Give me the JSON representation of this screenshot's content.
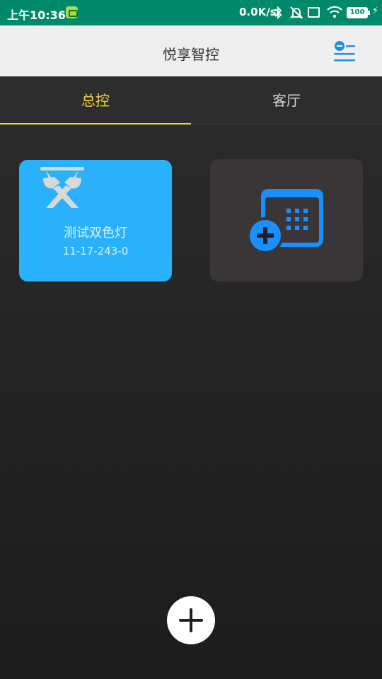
{
  "status_bar": {
    "time": "上午10:36",
    "net_speed": "0.0K/s",
    "battery": "100",
    "icons": [
      "app-notification-icon",
      "bluetooth-icon",
      "bell-muted-icon",
      "sim-off-icon",
      "wifi-icon",
      "battery-icon",
      "charging-icon"
    ]
  },
  "header": {
    "title": "悦享智控",
    "menu_icon": "list-menu-icon"
  },
  "tabs": [
    {
      "label": "总控",
      "active": true
    },
    {
      "label": "客厅",
      "active": false
    }
  ],
  "devices": [
    {
      "name": "测试双色灯",
      "code": "11-17-243-0",
      "icon": "lamp-icon",
      "color": "#29b1fb"
    }
  ],
  "add_device": {
    "icon": "calendar-add-icon",
    "color": "#1890ff"
  },
  "fab": {
    "icon": "plus-icon"
  },
  "colors": {
    "status_bar": "#00896b",
    "accent": "#f5d33a",
    "device_card": "#29b1fb"
  }
}
